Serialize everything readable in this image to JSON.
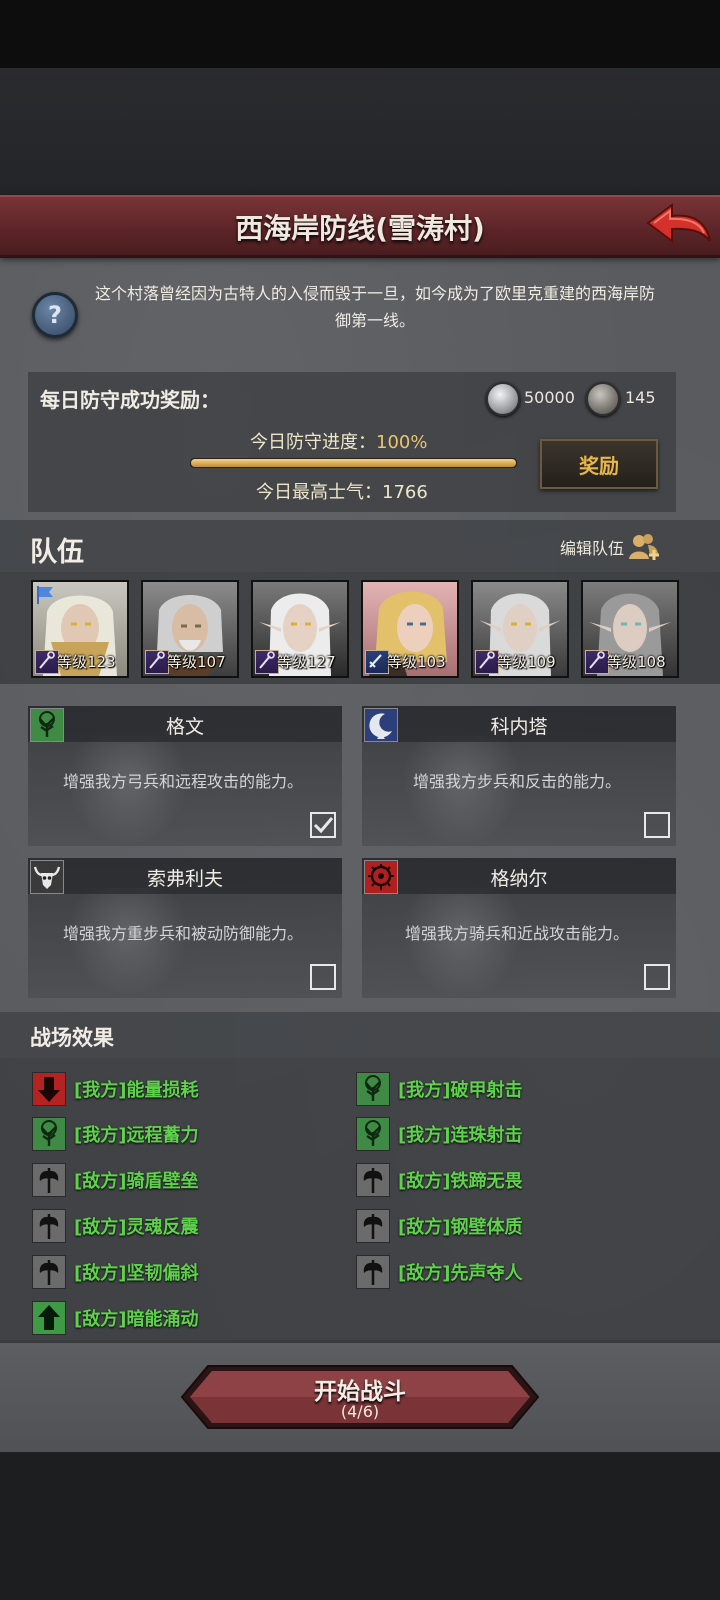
{
  "header": {
    "title": "西海岸防线(雪涛村)",
    "back_icon": "back-arrow-icon"
  },
  "intro": {
    "text": "这个村落曾经因为古特人的入侵而毁于一旦，如今成为了欧里克重建的西海岸防御第一线。",
    "help_icon": "question-mark-icon"
  },
  "reward": {
    "title": "每日防守成功奖励：",
    "silver_amount": "50000",
    "iron_amount": "145",
    "progress_label": "今日防守进度：",
    "progress_value": "100%",
    "progress_fraction": 1.0,
    "morale_label": "今日最高士气：1766",
    "claim_label": "奖励"
  },
  "team": {
    "title": "队伍",
    "edit_label": "编辑队伍",
    "heroes": [
      {
        "level": "等级123",
        "class": "staff"
      },
      {
        "level": "等级107",
        "class": "staff"
      },
      {
        "level": "等级127",
        "class": "staff"
      },
      {
        "level": "等级103",
        "class": "sword"
      },
      {
        "level": "等级109",
        "class": "staff"
      },
      {
        "level": "等级108",
        "class": "staff"
      }
    ]
  },
  "commanders": [
    {
      "name": "格文",
      "desc": "增强我方弓兵和远程攻击的能力。",
      "checked": true,
      "emblem": "tree-emblem-icon",
      "color": "#3f8a45"
    },
    {
      "name": "科内塔",
      "desc": "增强我方步兵和反击的能力。",
      "checked": false,
      "emblem": "moon-emblem-icon",
      "color": "#2d3f7a"
    },
    {
      "name": "索弗利夫",
      "desc": "增强我方重步兵和被动防御能力。",
      "checked": false,
      "emblem": "bull-skull-emblem-icon",
      "color": "#3a3a3a"
    },
    {
      "name": "格纳尔",
      "desc": "增强我方骑兵和近战攻击能力。",
      "checked": false,
      "emblem": "lion-emblem-icon",
      "color": "#b02020"
    }
  ],
  "effects": {
    "title": "战场效果",
    "items": [
      {
        "label": "[我方]能量损耗",
        "icon": "red-down-arrow-icon"
      },
      {
        "label": "[我方]破甲射击",
        "icon": "tree-icon"
      },
      {
        "label": "[我方]远程蓄力",
        "icon": "tree-icon"
      },
      {
        "label": "[我方]连珠射击",
        "icon": "tree-icon"
      },
      {
        "label": "[敌方]骑盾壁垒",
        "icon": "axe-icon"
      },
      {
        "label": "[敌方]铁蹄无畏",
        "icon": "axe-icon"
      },
      {
        "label": "[敌方]灵魂反震",
        "icon": "axe-icon"
      },
      {
        "label": "[敌方]钢壁体质",
        "icon": "axe-icon"
      },
      {
        "label": "[敌方]坚韧偏斜",
        "icon": "axe-icon"
      },
      {
        "label": "[敌方]先声夺人",
        "icon": "axe-icon"
      },
      {
        "label": "[敌方]暗能涌动",
        "icon": "green-up-arrow-icon"
      }
    ]
  },
  "start": {
    "label": "开始战斗",
    "count": "(4/6)"
  }
}
